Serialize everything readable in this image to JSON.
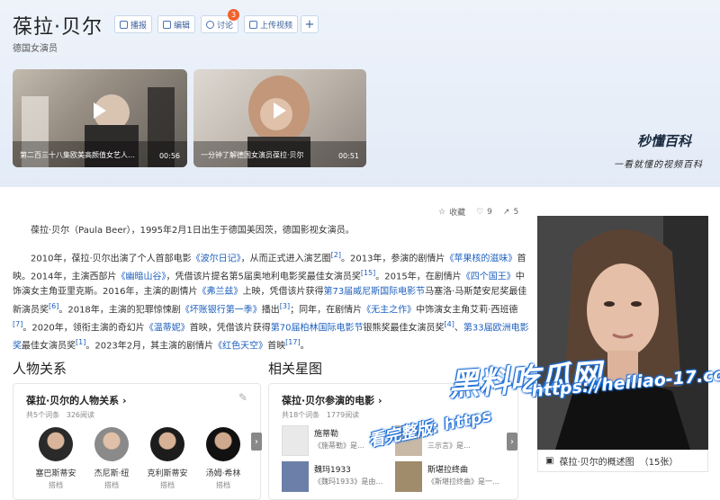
{
  "header": {
    "title": "葆拉·贝尔",
    "subtitle": "德国女演员",
    "toolbar": {
      "broadcast": "播报",
      "edit": "编辑",
      "discuss": "讨论",
      "discuss_count": "3",
      "upload_video": "上传视频",
      "add": "+"
    }
  },
  "videos": [
    {
      "caption": "第二百三十八集欧美高颜值女艺人…",
      "duration": "00:56"
    },
    {
      "caption": "一分钟了解德国女演员葆拉·贝尔",
      "duration": "00:51"
    }
  ],
  "brand": {
    "name": "秒懂百科",
    "slogan": "一看就懂的视频百科"
  },
  "actions": {
    "collect": "收藏",
    "likes": "9",
    "shares": "5"
  },
  "intro": {
    "p1": "葆拉·贝尔（Paula Beer），1995年2月1日出生于德国美因茨，德国影视女演员。",
    "p2_parts": [
      "2010年，葆拉·贝尔出演了个人首部电影",
      "《波尔日记》",
      "，从而正式进入演艺圈",
      "[2]",
      "。2013年，参演的剧情片",
      "《苹果核的滋味》",
      "首映。2014年，主演西部片",
      "《幽暗山谷》",
      "，凭借该片提名第5届奥地利电影奖最佳女演员奖",
      "[15]",
      "。2015年，在剧情片",
      "《四个国王》",
      "中饰演女主角亚里克斯。2016年，主演的剧情片",
      "《弗兰兹》",
      "上映，凭借该片获得",
      "第73届威尼斯国际电影节",
      "马塞洛·马斯楚安尼奖最佳新演员奖",
      "[6]",
      "。2018年，主演的犯罪惊悚剧",
      "《坏账银行第一季》",
      "播出",
      "[3]",
      "；同年，在剧情片",
      "《无主之作》",
      "中饰演女主角艾莉·西班德",
      "[7]",
      "。2020年，领衔主演的奇幻片",
      "《温蒂妮》",
      "首映，凭借该片获得",
      "第70届柏林国际电影节",
      "银熊奖最佳女演员奖",
      "[4]",
      "、",
      "第33届欧洲电影奖",
      "最佳女演员奖",
      "[1]",
      "。2023年2月，其主演的剧情片",
      "《红色天空》",
      "首映",
      "[17]",
      "。"
    ]
  },
  "photo": {
    "caption": "葆拉·贝尔的概述图",
    "count": "（15张）"
  },
  "relations": {
    "section_title": "人物关系",
    "card_title": "葆拉·贝尔的人物关系",
    "card_arrow": "›",
    "entries": "共5个词条",
    "reads": "326阅读",
    "people": [
      {
        "name": "塞巴斯蒂安",
        "role": "搭档"
      },
      {
        "name": "杰尼斯·纽",
        "role": "搭档"
      },
      {
        "name": "克利斯蒂安",
        "role": "搭档"
      },
      {
        "name": "汤姆·希林",
        "role": "搭档"
      }
    ]
  },
  "stars": {
    "section_title": "相关星图",
    "card_title": "葆拉·贝尔参演的电影",
    "card_arrow": "›",
    "entries": "共18个词条",
    "reads": "1779阅读",
    "films": [
      {
        "title": "施蒂勒",
        "desc": "《施蒂勒》是…"
      },
      {
        "title": "",
        "desc": "三示言》是…"
      },
      {
        "title": "魏玛1933",
        "desc": "《魏玛1933》是由…"
      },
      {
        "title": "斯堪拉终曲",
        "desc": "《斯堪拉终曲》是一…"
      }
    ]
  },
  "watermark": {
    "line1": "黑料吃瓜网",
    "line2": "https://heiliao-17.com",
    "line3": "看完整版: https"
  },
  "colors": {
    "link": "#1d5fbf",
    "accent": "#3a5f99",
    "badge": "#f0622d"
  }
}
